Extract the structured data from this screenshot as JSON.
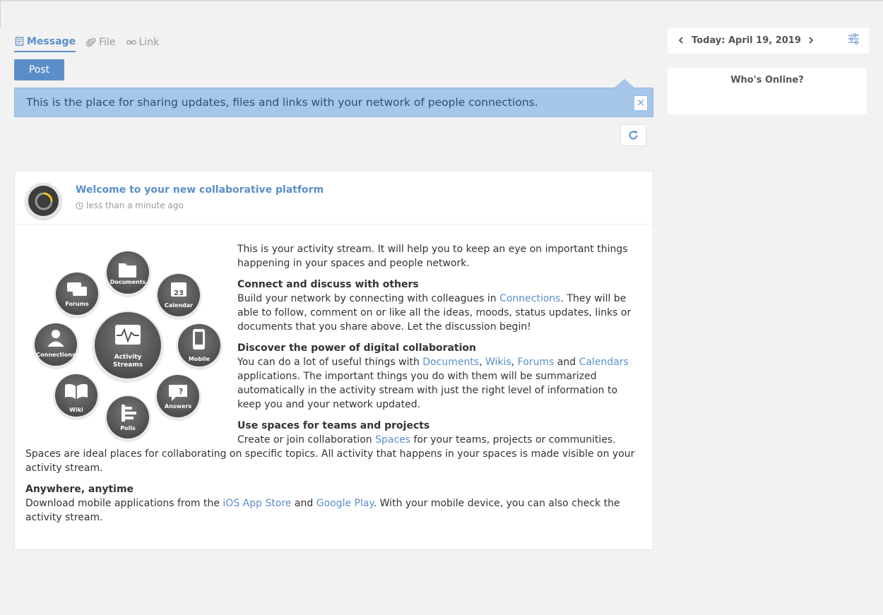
{
  "composer": {
    "tabs": [
      {
        "label": "Message",
        "icon": "message-icon",
        "active": true
      },
      {
        "label": "File",
        "icon": "paperclip-icon",
        "active": false
      },
      {
        "label": "Link",
        "icon": "link-icon",
        "active": false
      }
    ],
    "post_label": "Post"
  },
  "banner": {
    "text": "This is the place for sharing updates, files and links with your network of people connections.",
    "close_label": "×"
  },
  "post": {
    "title": "Welcome to your new collaborative platform",
    "time": "less than a minute ago",
    "graphic_labels": {
      "center_line1": "Activity",
      "center_line2": "Streams",
      "documents": "Documents",
      "forums": "Forums",
      "calendar": "Calendar",
      "calendar_day": "23",
      "connections": "Connections",
      "mobile": "Mobile",
      "wiki": "Wiki",
      "answers": "Answers",
      "polls": "Polls"
    },
    "intro": "This is your activity stream. It will help you to keep an eye on important things happening in your spaces and people network.",
    "s1_heading": "Connect and discuss with others",
    "s1_pre": "Build your network by connecting with colleagues in ",
    "s1_link": "Connections",
    "s1_post": ". They will be able to follow, comment on or like all the ideas, moods, status updates, links or documents that you share above. Let the discussion begin!",
    "s2_heading": "Discover the power of digital collaboration",
    "s2_pre": "You can do a lot of useful things with ",
    "s2_link1": "Documents",
    "s2_sep1": ", ",
    "s2_link2": "Wikis",
    "s2_sep2": ", ",
    "s2_link3": "Forums",
    "s2_and": " and ",
    "s2_link4": "Calendars",
    "s2_post": " applications. The important things you do with them will be summarized automatically in the activity stream with just the right level of information to keep you and your network updated.",
    "s3_heading": "Use spaces for teams and projects",
    "s3_pre": "Create or join collaboration ",
    "s3_link": "Spaces",
    "s3_post": " for your teams, projects or communities. Spaces are ideal places for collaborating on specific topics. All activity that happens in your spaces is made visible on your activity stream.",
    "s4_heading": "Anywhere, anytime",
    "s4_pre": "Download mobile applications from the ",
    "s4_link1": "iOS App Store",
    "s4_and": " and ",
    "s4_link2": "Google Play",
    "s4_post": ". With your mobile device, you can also check the activity stream."
  },
  "sidebar": {
    "date_label": "Today: April 19, 2019",
    "online_title": "Who's Online?"
  },
  "colors": {
    "accent": "#5b8ec9",
    "banner_bg": "#a7c7ea",
    "background": "#f2f2f2"
  }
}
